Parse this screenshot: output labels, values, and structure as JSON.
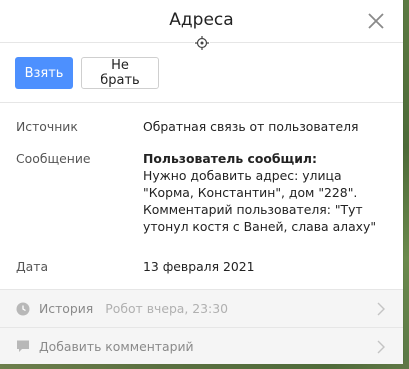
{
  "header": {
    "title": "Адреса"
  },
  "icons": {
    "close": "close-icon",
    "target": "crosshair-icon",
    "history": "clock-icon",
    "comment": "speech-bubble-icon",
    "chevron": "chevron-right-icon"
  },
  "colors": {
    "primary": "#4d90fe",
    "muted": "#8a8a8a",
    "footer_bg": "#f5f5f5"
  },
  "actions": {
    "take_label": "Взять",
    "dont_take_label": "Не брать"
  },
  "details": {
    "source_label": "Источник",
    "source_value": "Обратная связь от пользователя",
    "message_label": "Сообщение",
    "message_heading": "Пользователь сообщил:",
    "message_line1": "Нужно добавить адрес: улица \"Корма, Константин\", дом \"228\".",
    "message_line2": "Комментарий пользователя: \"Тут утонул костя с Ваней, слава алаху\"",
    "date_label": "Дата",
    "date_value": "13 февраля 2021"
  },
  "footer": {
    "history_label": "История",
    "history_meta": "Робот вчера, 23:30",
    "add_comment_label": "Добавить комментарий"
  }
}
